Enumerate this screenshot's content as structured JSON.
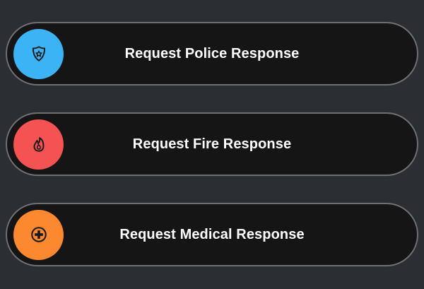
{
  "buttons": [
    {
      "label": "Request Police Response",
      "icon": "police-badge-icon",
      "color": "#3bb3f5"
    },
    {
      "label": "Request Fire Response",
      "icon": "fire-icon",
      "color": "#f55252"
    },
    {
      "label": "Request Medical Response",
      "icon": "medical-cross-icon",
      "color": "#fc8830"
    }
  ],
  "colors": {
    "background": "#2b2e33",
    "button_fill": "#151515",
    "button_border": "#6d6f73",
    "icon_stroke": "#1a1a1a"
  }
}
